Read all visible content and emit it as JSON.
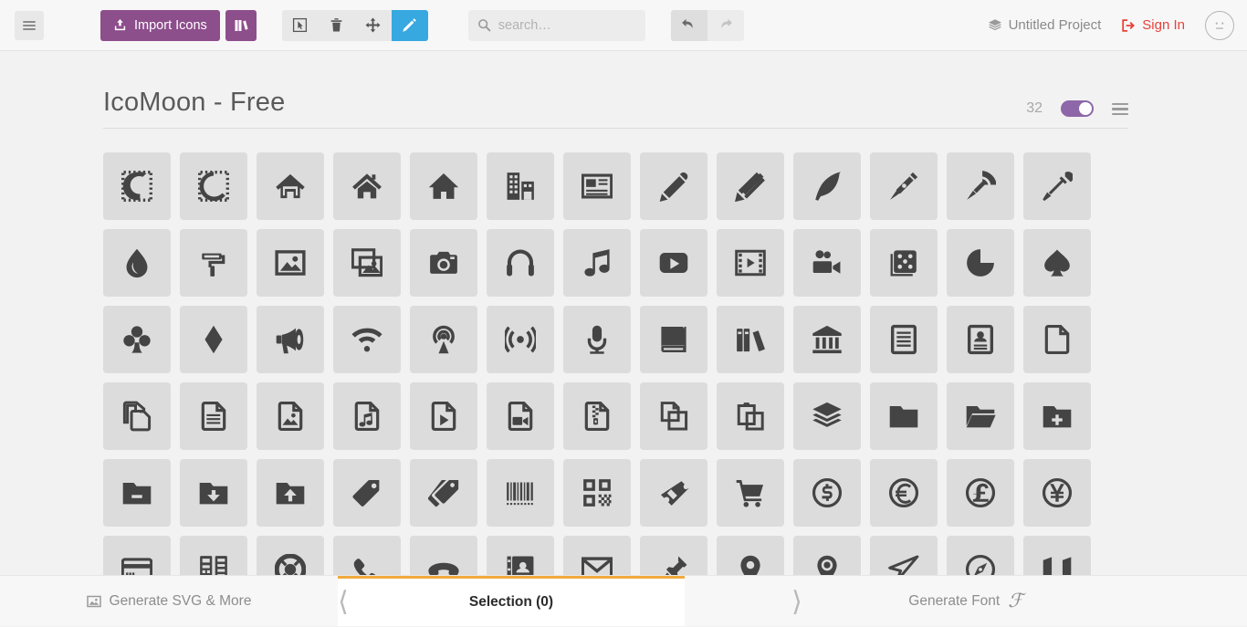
{
  "header": {
    "menu_icon": "hamburger-icon",
    "import_label": "Import Icons",
    "import_icon": "upload-icon",
    "library_icon": "books-icon",
    "tools": [
      {
        "name": "select-tool",
        "icon": "cursor-icon",
        "active": false
      },
      {
        "name": "delete-tool",
        "icon": "trash-icon",
        "active": false
      },
      {
        "name": "move-tool",
        "icon": "move-icon",
        "active": false
      },
      {
        "name": "edit-tool",
        "icon": "pencil-icon",
        "active": true
      }
    ],
    "search": {
      "value": "",
      "placeholder": "search…",
      "icon": "search-icon"
    },
    "undo": {
      "icon": "undo-arrow-icon",
      "enabled": true
    },
    "redo": {
      "icon": "redo-arrow-icon",
      "enabled": false
    },
    "project_label": "Untitled Project",
    "project_icon": "stack-icon",
    "signin_label": "Sign In",
    "signin_icon": "login-icon",
    "avatar_icon": "neutral-face-icon",
    "accent_purple": "#8d4e8c",
    "accent_blue": "#37a8e0",
    "accent_red": "#e8413a"
  },
  "set": {
    "title": "IcoMoon - Free",
    "count": "32",
    "toggle_on": true,
    "toggle_color": "#8d67a8",
    "menu_icon": "list-menu-icon"
  },
  "icons": [
    {
      "name": "icomoon-logo-text-icon"
    },
    {
      "name": "icomoon-logo-icon"
    },
    {
      "name": "home-icon"
    },
    {
      "name": "home2-icon"
    },
    {
      "name": "home3-icon"
    },
    {
      "name": "office-icon"
    },
    {
      "name": "newspaper-icon"
    },
    {
      "name": "pencil-icon"
    },
    {
      "name": "pencil2-icon"
    },
    {
      "name": "quill-icon"
    },
    {
      "name": "pen-icon"
    },
    {
      "name": "blog-icon"
    },
    {
      "name": "eyedropper-icon"
    },
    {
      "name": "droplet-icon"
    },
    {
      "name": "paint-format-icon"
    },
    {
      "name": "image-icon"
    },
    {
      "name": "images-icon"
    },
    {
      "name": "camera-icon"
    },
    {
      "name": "headphones-icon"
    },
    {
      "name": "music-icon"
    },
    {
      "name": "play-icon"
    },
    {
      "name": "film-icon"
    },
    {
      "name": "video-camera-icon"
    },
    {
      "name": "dice-icon"
    },
    {
      "name": "pacman-icon"
    },
    {
      "name": "spades-icon"
    },
    {
      "name": "clubs-icon"
    },
    {
      "name": "diamonds-icon"
    },
    {
      "name": "bullhorn-icon"
    },
    {
      "name": "connection-icon"
    },
    {
      "name": "podcast-icon"
    },
    {
      "name": "feed-icon"
    },
    {
      "name": "mic-icon"
    },
    {
      "name": "book-icon"
    },
    {
      "name": "books-icon"
    },
    {
      "name": "library-icon"
    },
    {
      "name": "file-text-icon"
    },
    {
      "name": "profile-icon"
    },
    {
      "name": "file-empty-icon"
    },
    {
      "name": "files-empty-icon"
    },
    {
      "name": "file-text2-icon"
    },
    {
      "name": "file-picture-icon"
    },
    {
      "name": "file-music-icon"
    },
    {
      "name": "file-play-icon"
    },
    {
      "name": "file-video-icon"
    },
    {
      "name": "file-zip-icon"
    },
    {
      "name": "copy-icon"
    },
    {
      "name": "paste-icon"
    },
    {
      "name": "stack-icon"
    },
    {
      "name": "folder-icon"
    },
    {
      "name": "folder-open-icon"
    },
    {
      "name": "folder-plus-icon"
    },
    {
      "name": "folder-minus-icon"
    },
    {
      "name": "folder-download-icon"
    },
    {
      "name": "folder-upload-icon"
    },
    {
      "name": "price-tag-icon"
    },
    {
      "name": "price-tags-icon"
    },
    {
      "name": "barcode-icon"
    },
    {
      "name": "qrcode-icon"
    },
    {
      "name": "ticket-icon"
    },
    {
      "name": "cart-icon"
    },
    {
      "name": "coin-dollar-icon"
    },
    {
      "name": "coin-euro-icon"
    },
    {
      "name": "coin-pound-icon"
    },
    {
      "name": "coin-yen-icon"
    },
    {
      "name": "credit-card-icon"
    },
    {
      "name": "calculator-icon"
    },
    {
      "name": "lifebuoy-icon"
    },
    {
      "name": "phone-icon"
    },
    {
      "name": "phone-hang-up-icon"
    },
    {
      "name": "address-book-icon"
    },
    {
      "name": "envelop-icon"
    },
    {
      "name": "pushpin-icon"
    },
    {
      "name": "location-icon"
    },
    {
      "name": "location2-icon"
    },
    {
      "name": "compass-icon"
    },
    {
      "name": "compass2-icon"
    },
    {
      "name": "map-icon"
    }
  ],
  "footer": {
    "generate_svg_label": "Generate SVG & More",
    "generate_svg_icon": "image-icon",
    "selection_label": "Selection (0)",
    "generate_font_label": "Generate Font",
    "generate_font_icon": "font-f-icon",
    "active_tab": "selection",
    "active_border_color": "#f0ab3c"
  }
}
